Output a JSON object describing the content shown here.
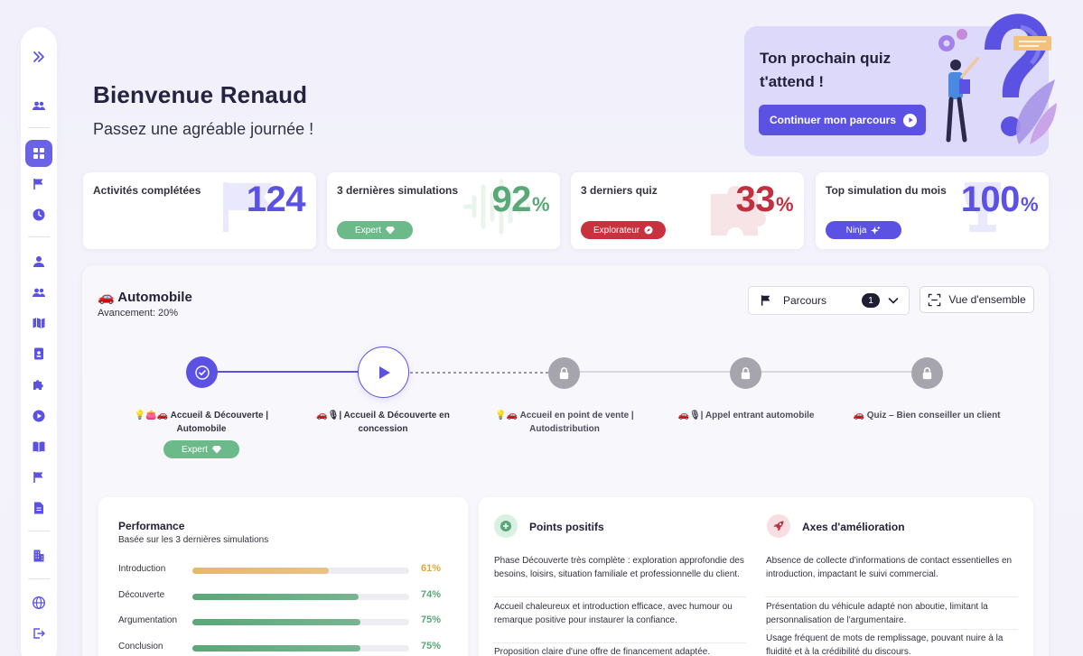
{
  "sidebar": {
    "items": [
      {
        "icon": "chevron-double-right-icon"
      },
      {
        "icon": "users-icon"
      },
      {
        "icon": "dashboard-grid-icon",
        "active": true
      },
      {
        "icon": "flag-icon"
      },
      {
        "icon": "clock-icon"
      },
      {
        "icon": "user-icon"
      },
      {
        "icon": "users-group-icon"
      },
      {
        "icon": "map-icon"
      },
      {
        "icon": "id-badge-icon"
      },
      {
        "icon": "puzzle-icon"
      },
      {
        "icon": "play-circle-icon"
      },
      {
        "icon": "book-icon"
      },
      {
        "icon": "flag-icon"
      },
      {
        "icon": "document-icon"
      },
      {
        "icon": "building-icon"
      },
      {
        "icon": "globe-icon"
      },
      {
        "icon": "logout-icon"
      }
    ]
  },
  "header": {
    "title": "Bienvenue Renaud",
    "subtitle": "Passez une agréable journée !"
  },
  "quiz_card": {
    "title": "Ton prochain quiz t'attend !",
    "button_label": "Continuer mon parcours"
  },
  "stats": [
    {
      "label": "Activités complétées",
      "value": "124",
      "unit": "",
      "color": "#5b52e3"
    },
    {
      "label": "3 dernières simulations",
      "value": "92",
      "unit": "%",
      "color": "#5aa777",
      "badge": "Expert",
      "badge_color": "#6cb98a"
    },
    {
      "label": "3 derniers quiz",
      "value": "33",
      "unit": "%",
      "color": "#c1303f",
      "badge": "Explorateur",
      "badge_color": "#c8323f"
    },
    {
      "label": "Top simulation du mois",
      "value": "100",
      "unit": "%",
      "color": "#5b52e3",
      "badge": "Ninja",
      "badge_color": "#5b52e3"
    }
  ],
  "course": {
    "title": "🚗 Automobile",
    "progress_text": "Avancement: 20%",
    "progress": 0.2,
    "parcours_label": "Parcours",
    "parcours_count": "1",
    "overview_label": "Vue d'ensemble",
    "steps": [
      {
        "label": "💡👛🚗 Accueil & Découverte | Automobile",
        "state": "done",
        "badge": "Expert"
      },
      {
        "label": "🚗🎙| Accueil & Découverte en concession",
        "state": "current"
      },
      {
        "label": "💡🚗 Accueil en point de vente | Autodistribution",
        "state": "locked"
      },
      {
        "label": "🚗🎙| Appel entrant automobile",
        "state": "locked"
      },
      {
        "label": "🚗 Quiz – Bien conseiller un client",
        "state": "locked"
      }
    ]
  },
  "performance": {
    "title": "Performance",
    "subtitle": "Basée sur les 3 dernières simulations",
    "rows": [
      {
        "label": "Introduction",
        "value": 61,
        "display": "61%",
        "color": "#e8b866"
      },
      {
        "label": "Découverte",
        "value": 74,
        "display": "74%",
        "color": "#5aa777"
      },
      {
        "label": "Argumentation",
        "value": 75,
        "display": "75%",
        "color": "#5aa777"
      },
      {
        "label": "Conclusion",
        "value": 75,
        "display": "75%",
        "color": "#5aa777"
      }
    ]
  },
  "feedback": {
    "positive_title": "Points positifs",
    "positive_items": [
      "Phase Découverte très complète : exploration approfondie des besoins, loisirs, situation familiale et professionnelle du client.",
      "Accueil chaleureux et introduction efficace, avec humour ou remarque positive pour instaurer la confiance.",
      "Proposition claire d'une offre de financement adaptée."
    ],
    "improvement_title": "Axes d'amélioration",
    "improvement_items": [
      "Absence de collecte d'informations de contact essentielles en introduction, impactant le suivi commercial.",
      "Présentation du véhicule adapté non aboutie, limitant la personnalisation de l'argumentaire.",
      "Usage fréquent de mots de remplissage, pouvant nuire à la fluidité et à la crédibilité du discours."
    ]
  }
}
